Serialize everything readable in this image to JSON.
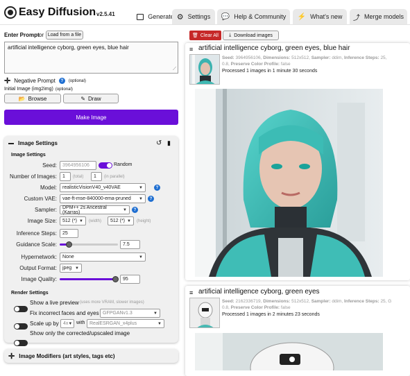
{
  "app": {
    "title": "Easy Diffusion",
    "version": "v2.5.41"
  },
  "tabs": [
    {
      "label": "Generate",
      "icon": "image-icon"
    },
    {
      "label": "Settings",
      "icon": "gear-icon"
    },
    {
      "label": "Help & Community",
      "icon": "comments-icon"
    },
    {
      "label": "What's new",
      "icon": "bolt-icon"
    },
    {
      "label": "Merge models",
      "icon": "merge-icon"
    }
  ],
  "prompt": {
    "label": "Enter Prompt",
    "or": "or",
    "load_button": "Load from a file",
    "value": "artificial intelligence cyborg, green eyes, blue hair",
    "negative_label": "Negative Prompt",
    "optional": "(optional)",
    "init_image_label": "Initial Image (img2img)",
    "browse_button": "Browse",
    "draw_button": "Draw",
    "make_image_button": "Make Image"
  },
  "image_settings": {
    "title": "Image Settings",
    "subtitle": "Image Settings",
    "seed_label": "Seed:",
    "seed_value": "3964956106",
    "random_label": "Random",
    "num_images_label": "Number of Images:",
    "num_images_total": "1",
    "total_hint": "(total)",
    "num_images_parallel": "1",
    "parallel_hint": "(in parallel)",
    "model_label": "Model:",
    "model_value": "realisticVisionV40_v40VAE",
    "vae_label": "Custom VAE:",
    "vae_value": "vae-ft-mse-840000-ema-pruned",
    "sampler_label": "Sampler:",
    "sampler_value": "DPM++ 2s Ancestral (Karras)",
    "size_label": "Image Size:",
    "width_value": "512 (*)",
    "width_hint": "(width)",
    "height_value": "512 (*)",
    "height_hint": "(height)",
    "steps_label": "Inference Steps:",
    "steps_value": "25",
    "guidance_label": "Guidance Scale:",
    "guidance_value": "7.5",
    "guidance_fraction": 0.16,
    "hypernetwork_label": "Hypernetwork:",
    "hypernetwork_value": "None",
    "format_label": "Output Format:",
    "format_value": "jpeg",
    "quality_label": "Image Quality:",
    "quality_value": "95",
    "quality_fraction": 0.95
  },
  "render_settings": {
    "title": "Render Settings",
    "live_preview": "Show a live preview",
    "live_preview_hint": "(uses more VRAM, slower images)",
    "fix_faces": "Fix incorrect faces and eyes",
    "fix_faces_model": "GFPGANv1.3",
    "scale_up": "Scale up by",
    "scale_value": "4x",
    "with": "with",
    "upscaler_value": "RealESRGAN_x4plus",
    "show_corrected": "Show only the corrected/upscaled image"
  },
  "image_modifiers": {
    "title": "Image Modifiers (art styles, tags etc)"
  },
  "toolbar": {
    "clear_all": "Clear All",
    "download": "Download images"
  },
  "results": [
    {
      "prompt": "artificial intelligence cyborg, green eyes, blue hair",
      "seed_key": "Seed:",
      "seed": "3964956106,",
      "dims_key": "Dimensions:",
      "dims": "512x512,",
      "sampler_key": "Sampler:",
      "sampler": "ddim,",
      "steps_key": "Inference Steps:",
      "steps": "25,",
      "guidance": "0.8,",
      "profile_key": "Preserve Color Profile:",
      "profile": "false",
      "processed": "Processed 1 images in 1 minute 30 seconds"
    },
    {
      "prompt": "artificial intelligence cyborg, green eyes",
      "seed_key": "Seed:",
      "seed": "2162336719,",
      "dims_key": "Dimensions:",
      "dims": "512x512,",
      "sampler_key": "Sampler:",
      "sampler": "ddim,",
      "steps_key": "Inference Steps:",
      "steps": "25, G",
      "guidance": "0.8,",
      "profile_key": "Preserve Color Profile:",
      "profile": "false",
      "processed": "Processed 1 images in 2 minutes 23 seconds"
    }
  ],
  "colors": {
    "accent": "#6a0fd9",
    "danger": "#c62828",
    "info": "#1f6fd1"
  }
}
